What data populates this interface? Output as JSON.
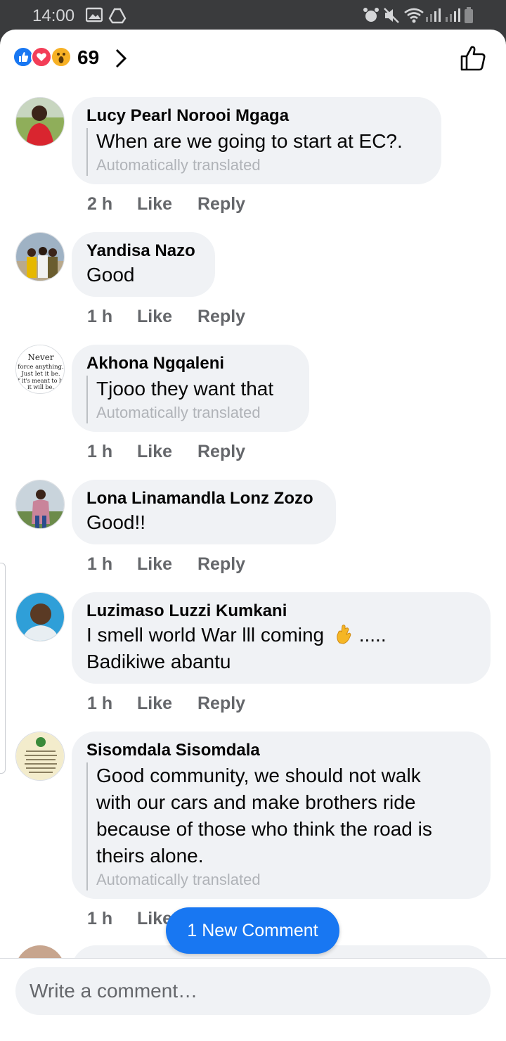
{
  "status_bar": {
    "time": "14:00"
  },
  "header": {
    "reaction_count": "69",
    "reactions": [
      "like-icon",
      "love-icon",
      "wow-icon"
    ]
  },
  "comments": [
    {
      "name": "Lucy Pearl Norooi Mgaga",
      "text": "When are we going to start at EC?.",
      "translated": true,
      "auto_label": "Automatically translated",
      "time": "2 h",
      "like": "Like",
      "reply": "Reply"
    },
    {
      "name": "Yandisa Nazo",
      "text": "Good",
      "translated": false,
      "time": "1 h",
      "like": "Like",
      "reply": "Reply"
    },
    {
      "name": "Akhona Ngqaleni",
      "text": "Tjooo they want that",
      "translated": true,
      "auto_label": "Automatically translated",
      "time": "1 h",
      "like": "Like",
      "reply": "Reply"
    },
    {
      "name": "Lona Linamandla Lonz Zozo",
      "text": "Good!!",
      "translated": false,
      "time": "1 h",
      "like": "Like",
      "reply": "Reply"
    },
    {
      "name": "Luzimaso Luzzi Kumkani",
      "text_line1": "I smell world War lll coming",
      "text_line1_suffix": ".....",
      "text_line2": "Badikiwe abantu",
      "translated": false,
      "time": "1 h",
      "like": "Like",
      "reply": "Reply"
    },
    {
      "name": "Sisomdala Sisomdala",
      "text_lines": [
        "Good community, we should not walk",
        "with our cars and make brothers ride",
        "because of those who think the road is",
        "theirs alone."
      ],
      "translated": true,
      "auto_label": "Automatically translated",
      "time": "1 h",
      "like": "Like"
    }
  ],
  "avatar3_text": [
    "Never",
    "force anything.",
    "Just let it be.",
    "If it's meant to be",
    "it will be."
  ],
  "new_comment_button": "1 New Comment",
  "composer": {
    "placeholder": "Write a comment…"
  },
  "colors": {
    "accent": "#1877f2",
    "bubble": "#f0f2f5",
    "secondary_text": "#65676b"
  }
}
